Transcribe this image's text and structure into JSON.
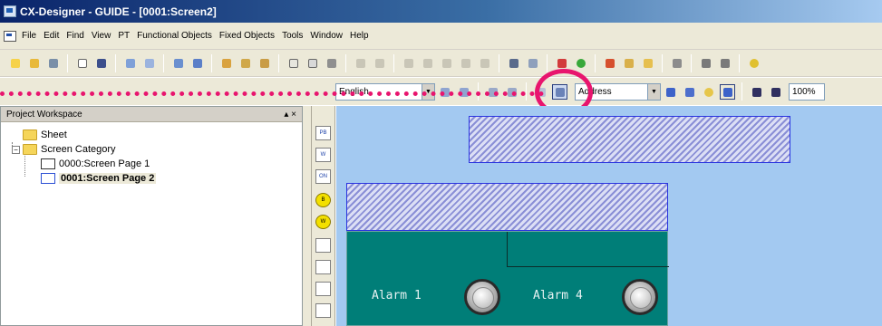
{
  "window": {
    "title": "CX-Designer - GUIDE - [0001:Screen2]"
  },
  "menu": [
    "File",
    "Edit",
    "Find",
    "View",
    "PT",
    "Functional Objects",
    "Fixed Objects",
    "Tools",
    "Window",
    "Help"
  ],
  "toolbar2": {
    "language_combo": "English",
    "address_combo": "Address",
    "zoom_combo": "100%"
  },
  "workspace": {
    "title": "Project Workspace",
    "pin": "▴ ×",
    "tree": [
      {
        "label": "Sheet"
      },
      {
        "label": "Screen Category"
      },
      {
        "label": "0000:Screen Page 1"
      },
      {
        "label": "0001:Screen Page 2"
      }
    ]
  },
  "vertical_toolbar": [
    "PB",
    "W",
    "ON",
    "B",
    "W",
    "",
    "",
    "",
    ""
  ],
  "screen": {
    "alarm1": "Alarm 1",
    "alarm4": "Alarm 4"
  },
  "colors": {
    "highlight": "#e8156e",
    "canvas": "#a3c9f1",
    "panel": "#007e78"
  }
}
